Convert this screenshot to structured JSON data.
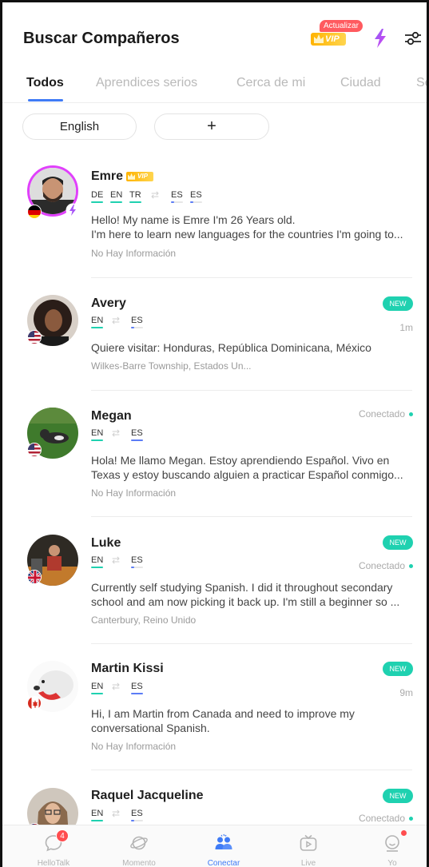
{
  "header": {
    "title": "Buscar Compañeros",
    "update_label": "Actualizar",
    "vip_label": "VIP"
  },
  "tabs": [
    {
      "label": "Todos",
      "active": true
    },
    {
      "label": "Aprendices serios"
    },
    {
      "label": "Cerca de mi"
    },
    {
      "label": "Ciudad"
    },
    {
      "label": "Se"
    }
  ],
  "filters": {
    "language_chip": "English",
    "add_chip": "+"
  },
  "users": [
    {
      "name": "Emre",
      "vip": "VIP",
      "native": [
        "DE",
        "EN",
        "TR"
      ],
      "learning": [
        "ES",
        "ES"
      ],
      "bio_line1": "Hello! My name is Emre I'm 26 Years old.",
      "bio_line2": "I'm here to learn new languages for the countries I'm going to...",
      "location": "No Hay Información",
      "flag": "germany",
      "avatar": "man-beard-avatar"
    },
    {
      "name": "Avery",
      "badge": "NEW",
      "time": "1m",
      "native": [
        "EN"
      ],
      "learning": [
        "ES"
      ],
      "bio_line1": "Quiere visitar: Honduras, República Dominicana, México",
      "location": "Wilkes-Barre Township, Estados Un...",
      "flag": "usa",
      "avatar": "woman-curly-hair-avatar"
    },
    {
      "name": "Megan",
      "status": "Conectado",
      "native": [
        "EN"
      ],
      "learning": [
        "ES"
      ],
      "bio_line1": "Hola! Me llamo Megan. Estoy aprendiendo Español. Vivo en",
      "bio_line2": "Texas y estoy buscando alguien a practicar Español conmigo...",
      "location": "No Hay Información",
      "flag": "usa",
      "avatar": "dog-on-grass-avatar"
    },
    {
      "name": "Luke",
      "badge": "NEW",
      "status": "Conectado",
      "native": [
        "EN"
      ],
      "learning": [
        "ES"
      ],
      "bio_line1": "Currently self studying Spanish. I did it throughout secondary",
      "bio_line2": "school and am now picking it back up. I'm still a beginner so ...",
      "location": "Canterbury, Reino Unido",
      "flag": "uk",
      "avatar": "man-sitting-avatar"
    },
    {
      "name": "Martin Kissi",
      "badge": "NEW",
      "time": "9m",
      "native": [
        "EN"
      ],
      "learning": [
        "ES"
      ],
      "bio_line1": "Hi, I am Martin from Canada and need to improve my",
      "bio_line2": "conversational Spanish.",
      "location": "No Hay Información",
      "flag": "canada",
      "avatar": "white-dog-avatar"
    },
    {
      "name": "Raquel Jacqueline",
      "badge": "NEW",
      "status": "Conectado",
      "native": [
        "EN"
      ],
      "learning": [
        "ES"
      ],
      "flag": "usa",
      "avatar": "woman-glasses-avatar"
    }
  ],
  "bottom_nav": [
    {
      "label": "HelloTalk",
      "icon": "chat-bubble-icon",
      "badge": "4"
    },
    {
      "label": "Momento",
      "icon": "planet-icon"
    },
    {
      "label": "Conectar",
      "icon": "people-icon",
      "active": true
    },
    {
      "label": "Live",
      "icon": "tv-play-icon"
    },
    {
      "label": "Yo",
      "icon": "smiley-profile-icon"
    }
  ],
  "colors": {
    "accent": "#3f7bf6",
    "native_bar": "#1fd1b0",
    "learning_bar": "#5b7cf6",
    "new_badge": "#1fd1b0",
    "vip_gold": "#ffb300",
    "avatar_ring": "#e040fb"
  }
}
